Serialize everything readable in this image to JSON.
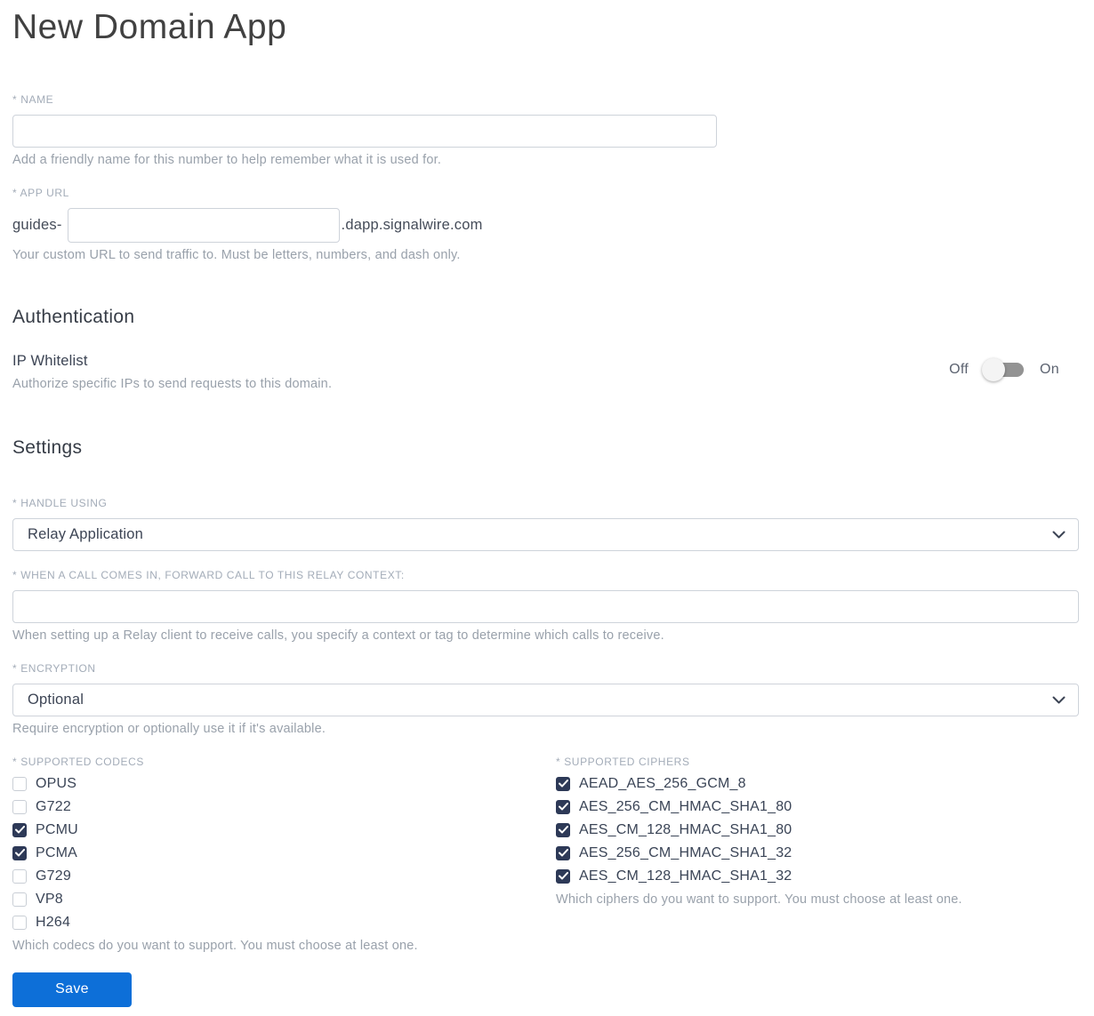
{
  "page": {
    "title": "New Domain App"
  },
  "name_field": {
    "label": "* NAME",
    "value": "",
    "helper": "Add a friendly name for this number to help remember what it is used for."
  },
  "app_url_field": {
    "label": "* APP URL",
    "prefix": "guides-",
    "value": "",
    "suffix": ".dapp.signalwire.com",
    "helper": "Your custom URL to send traffic to. Must be letters, numbers, and dash only."
  },
  "authentication": {
    "heading": "Authentication",
    "ip_whitelist": {
      "label": "IP Whitelist",
      "helper": "Authorize specific IPs to send requests to this domain.",
      "off_label": "Off",
      "on_label": "On",
      "state": "off"
    }
  },
  "settings": {
    "heading": "Settings",
    "handle_using": {
      "label": "* HANDLE USING",
      "selected": "Relay Application"
    },
    "relay_context": {
      "label": "* WHEN A CALL COMES IN, FORWARD CALL TO THIS RELAY CONTEXT:",
      "value": "",
      "helper": "When setting up a Relay client to receive calls, you specify a context or tag to determine which calls to receive."
    },
    "encryption": {
      "label": "* ENCRYPTION",
      "selected": "Optional",
      "helper": "Require encryption or optionally use it if it's available."
    },
    "codecs": {
      "label": "* SUPPORTED CODECS",
      "options": [
        {
          "label": "OPUS",
          "checked": false
        },
        {
          "label": "G722",
          "checked": false
        },
        {
          "label": "PCMU",
          "checked": true
        },
        {
          "label": "PCMA",
          "checked": true
        },
        {
          "label": "G729",
          "checked": false
        },
        {
          "label": "VP8",
          "checked": false
        },
        {
          "label": "H264",
          "checked": false
        }
      ],
      "helper": "Which codecs do you want to support. You must choose at least one."
    },
    "ciphers": {
      "label": "* SUPPORTED CIPHERS",
      "options": [
        {
          "label": "AEAD_AES_256_GCM_8",
          "checked": true
        },
        {
          "label": "AES_256_CM_HMAC_SHA1_80",
          "checked": true
        },
        {
          "label": "AES_CM_128_HMAC_SHA1_80",
          "checked": true
        },
        {
          "label": "AES_256_CM_HMAC_SHA1_32",
          "checked": true
        },
        {
          "label": "AES_CM_128_HMAC_SHA1_32",
          "checked": true
        }
      ],
      "helper": "Which ciphers do you want to support. You must choose at least one."
    }
  },
  "actions": {
    "save_label": "Save"
  },
  "colors": {
    "accent_blue": "#0d6fd8",
    "checkbox_checked": "#2d3957",
    "toggle_track": "#939393",
    "label_gray": "#a3acb8",
    "helper_gray": "#99a1ab"
  }
}
